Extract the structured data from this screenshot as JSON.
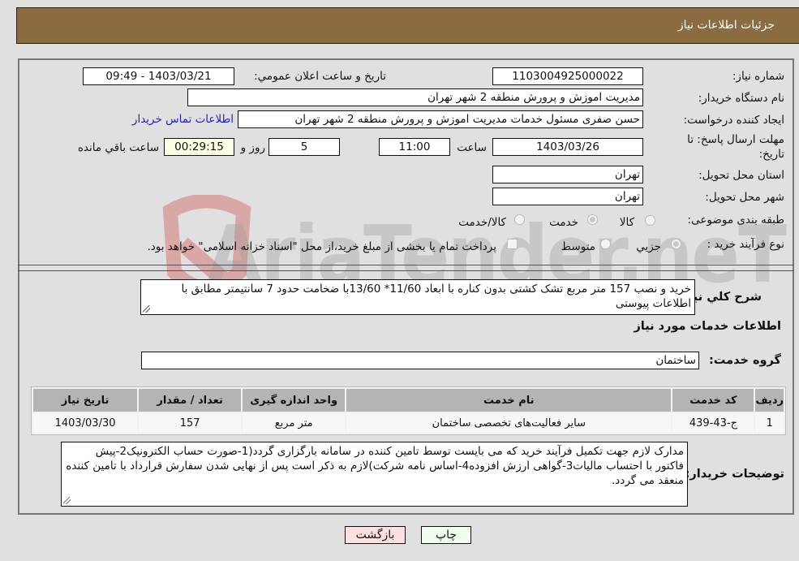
{
  "header": {
    "title": "جزئیات اطلاعات نیاز"
  },
  "form": {
    "need_number": {
      "label": "شماره نیاز:",
      "value": "1103004925000022"
    },
    "announce_datetime": {
      "label": "تاریخ و ساعت اعلان عمومي:",
      "value": "1403/03/21 - 09:49"
    },
    "buyer_org": {
      "label": "نام دستگاه خریدار:",
      "value": "مدیریت اموزش و پرورش منطقه 2 شهر تهران"
    },
    "requester": {
      "label": "ایجاد کننده درخواست:",
      "value": "حسن صفری مسئول خدمات مدیریت اموزش و پرورش منطقه 2 شهر تهران"
    },
    "buyer_contact_link": "اطلاعات تماس خریدار",
    "deadline": {
      "label_line1": "مهلت ارسال پاسخ: تا",
      "label_line2": "تاریخ:",
      "date": "1403/03/26",
      "time_label": "ساعت",
      "time": "11:00",
      "days": "5",
      "days_label": "روز و",
      "remaining": "00:29:15",
      "remaining_label": "ساعت باقي مانده"
    },
    "delivery_province": {
      "label": "استان محل تحویل:",
      "value": "تهران"
    },
    "delivery_city": {
      "label": "شهر محل تحویل:",
      "value": "تهران"
    },
    "category": {
      "label": "طبقه بندی موضوعی:",
      "options": [
        {
          "label": "کالا",
          "checked": false
        },
        {
          "label": "خدمت",
          "checked": true
        },
        {
          "label": "کالا/خدمت",
          "checked": false
        }
      ]
    },
    "purchase_type": {
      "label": "نوع فرآیند خرید :",
      "options": [
        {
          "label": "جزيي",
          "checked": true
        },
        {
          "label": "متوسط",
          "checked": false
        }
      ],
      "treasury_checkbox_label": "پرداخت تمام یا بخشی از مبلغ خرید،از محل \"اسناد خزانه اسلامی\" خواهد بود.",
      "treasury_checked": false
    }
  },
  "description": {
    "label": "شرح کلي نیاز:",
    "value": "خرید و نصب 157 متر مربع تشک کشتی بدون کناره با ابعاد 11/60* 13/60با  ضخامت حدود 7 سانتیمتر مطابق با اطلاعات پیوستی"
  },
  "services_section": {
    "title": "اطلاعات خدمات مورد نیاز",
    "group_label": "گروه خدمت:",
    "group_value": "ساختمان",
    "table": {
      "headers": [
        "ردیف",
        "کد خدمت",
        "نام خدمت",
        "واحد اندازه گیری",
        "تعداد / مقدار",
        "تاریخ نیاز"
      ],
      "rows": [
        [
          "1",
          "ج-43-439",
          "سایر فعالیت‌های تخصصی ساختمان",
          "متر مربع",
          "157",
          "1403/03/30"
        ]
      ]
    }
  },
  "buyer_notes": {
    "label": "توضیحات خریدار:",
    "value": "مدارک لازم جهت تکمیل فرآیند خرید که می بایست توسط تامین کننده در سامانه بارگزاری گردد(1-صورت حساب الکترونیک2-پیش فاکتور با احتساب مالیات3-گواهی ارزش افزوده4-اساس نامه شرکت)لازم به ذکر است پس از نهایی شدن سفارش قرارداد با تامین کننده منعقد می گردد."
  },
  "buttons": {
    "print": "چاپ",
    "back": "بازگشت"
  },
  "watermark": "AriaTender.neT",
  "colors": {
    "header": "#8b6b40",
    "link": "#2020cc",
    "print_bg": "#eeffee",
    "back_bg": "#ffe0e0",
    "remaining_bg": "#ffffe6"
  }
}
